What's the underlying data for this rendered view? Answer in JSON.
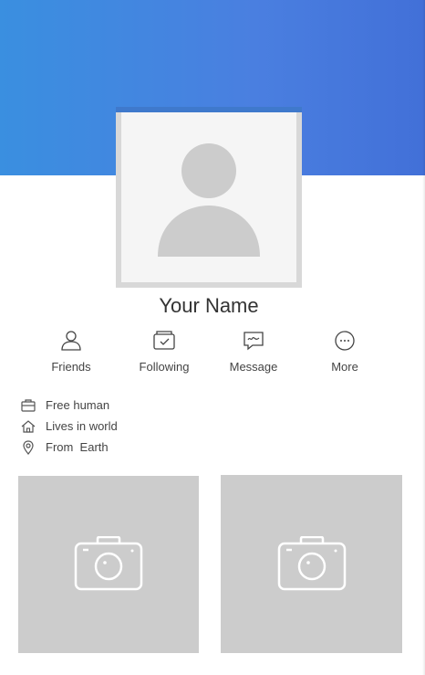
{
  "profile": {
    "name": "Your Name"
  },
  "actions": [
    {
      "label": "Friends",
      "icon": "person-icon"
    },
    {
      "label": "Following",
      "icon": "following-icon"
    },
    {
      "label": "Message",
      "icon": "message-icon"
    },
    {
      "label": "More",
      "icon": "more-icon"
    }
  ],
  "info": [
    {
      "text": "Free human",
      "icon": "briefcase-icon"
    },
    {
      "text": "Lives in world",
      "icon": "home-icon"
    },
    {
      "text": "From  Earth",
      "icon": "location-pin-icon"
    }
  ],
  "photos": [
    {
      "icon": "camera-icon"
    },
    {
      "icon": "camera-icon"
    }
  ],
  "colors": {
    "cover_start": "#3a8fe0",
    "cover_end": "#4270d8",
    "placeholder": "#cccccc",
    "text": "#333333"
  }
}
